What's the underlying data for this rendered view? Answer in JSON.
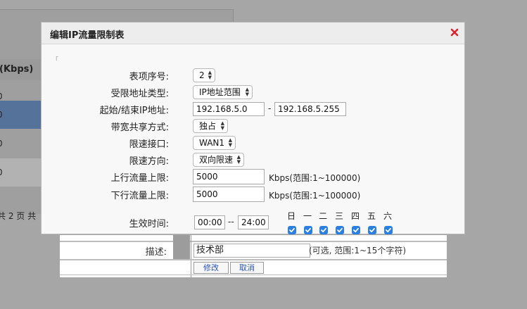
{
  "background": {
    "column_header": "限(Kbps)",
    "rows": [
      "0",
      "0",
      "0",
      "0"
    ],
    "pager": "共 2 页 共"
  },
  "lower_form": {
    "description_label": "描述:",
    "description_value": "技术部",
    "description_hint": "(可选, 范围:1~15个字符)",
    "modify_button": "修改",
    "cancel_button": "取消"
  },
  "dialog": {
    "title": "编辑IP流量限制表",
    "close_icon": "close-x-icon",
    "fields": {
      "entry_no": {
        "label": "表项序号:",
        "value": "2"
      },
      "addr_type": {
        "label": "受限地址类型:",
        "value": "IP地址范围"
      },
      "ip_range": {
        "label": "起始/结束IP地址:",
        "start": "192.168.5.0",
        "separator": "-",
        "end": "192.168.5.255"
      },
      "share_mode": {
        "label": "带宽共享方式:",
        "value": "独占"
      },
      "interface": {
        "label": "限速接口:",
        "value": "WAN1"
      },
      "direction": {
        "label": "限速方向:",
        "value": "双向限速"
      },
      "upload": {
        "label": "上行流量上限:",
        "value": "5000",
        "hint": "Kbps(范围:1~100000)"
      },
      "download": {
        "label": "下行流量上限:",
        "value": "5000",
        "hint": "Kbps(范围:1~100000)"
      },
      "schedule": {
        "label": "生效时间:",
        "start": "00:00",
        "separator": "--",
        "end": "24:00"
      }
    },
    "weekdays": [
      {
        "label": "日",
        "checked": true
      },
      {
        "label": "一",
        "checked": true
      },
      {
        "label": "二",
        "checked": true
      },
      {
        "label": "三",
        "checked": true
      },
      {
        "label": "四",
        "checked": true
      },
      {
        "label": "五",
        "checked": true
      },
      {
        "label": "六",
        "checked": true
      }
    ],
    "colors": {
      "checkbox": "#2a7fe0",
      "close_icon": "#d9232d",
      "highlight_row": "#55739a"
    }
  }
}
